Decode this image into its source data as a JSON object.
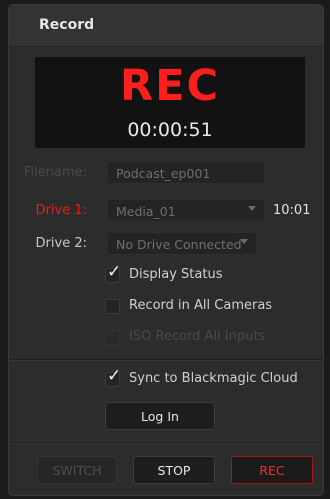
{
  "panel": {
    "title": "Record"
  },
  "monitor": {
    "status": "REC",
    "timecode": "00:00:51"
  },
  "filename": {
    "label": "Filename:",
    "value": "Podcast_ep001"
  },
  "drive1": {
    "label": "Drive 1:",
    "value": "Media_01",
    "time": "10:01"
  },
  "drive2": {
    "label": "Drive 2:",
    "value": "No Drive Connected"
  },
  "options": {
    "display_status": {
      "label": "Display Status",
      "checked": true
    },
    "record_all_cameras": {
      "label": "Record in All Cameras",
      "checked": false
    },
    "iso_record": {
      "label": "ISO Record All Inputs",
      "checked": false
    }
  },
  "cloud": {
    "sync": {
      "label": "Sync to Blackmagic Cloud",
      "checked": true
    },
    "login_label": "Log In"
  },
  "footer": {
    "switch_label": "SWITCH",
    "stop_label": "STOP",
    "rec_label": "REC"
  },
  "colors": {
    "accent_red": "#ff1e1e",
    "label_red": "#e02020",
    "background": "#2c2c2c"
  },
  "icons": {
    "check": "checkmark-icon",
    "dropdown": "chevron-down-icon"
  }
}
